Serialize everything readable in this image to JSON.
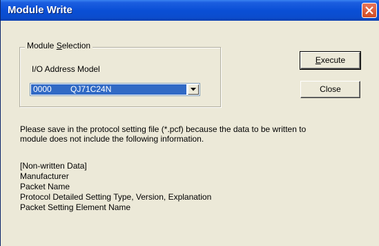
{
  "window": {
    "title": "Module Write"
  },
  "module_selection": {
    "group_title_pre": "Module ",
    "group_title_accel": "S",
    "group_title_post": "election",
    "column_label": "I/O Address Model",
    "selected_address": "0000",
    "selected_model": "QJ71C24N"
  },
  "buttons": {
    "execute_accel": "E",
    "execute_rest": "xecute",
    "close_label": "Close"
  },
  "message": {
    "line1": "Please save in the protocol setting file (*.pcf) because the data to be written to",
    "line2": "module does not include the following information.",
    "section_header": "[Non-written Data]",
    "items": [
      "Manufacturer",
      "Packet Name",
      "Protocol Detailed Setting Type, Version, Explanation",
      "Packet Setting Element Name"
    ]
  }
}
